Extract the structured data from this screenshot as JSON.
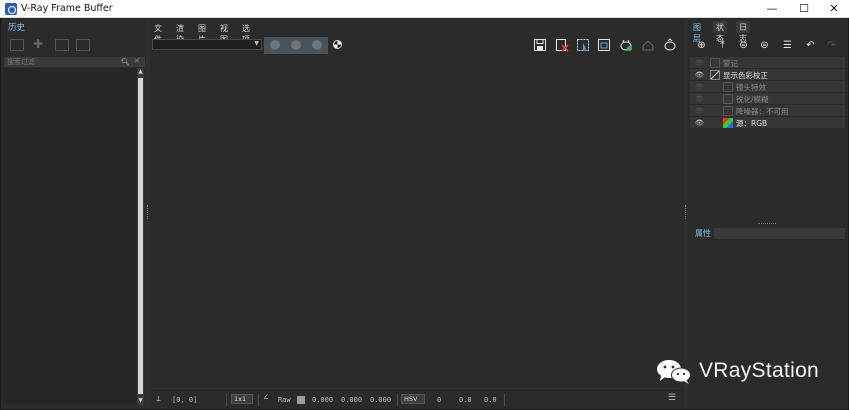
{
  "window": {
    "title": "V-Ray Frame Buffer",
    "controls": {
      "minimize": "—",
      "maximize": "☐",
      "close": "✕"
    }
  },
  "left_panel": {
    "tab": "历史",
    "search": {
      "placeholder": "搜索过滤",
      "value": ""
    },
    "toolbar_icons": [
      "save-to-history-icon",
      "add-history-icon",
      "load-history-icon",
      "export-history-icon"
    ]
  },
  "menubar": [
    "文件",
    "渲染",
    "图片",
    "视图",
    "选项"
  ],
  "toolbar": {
    "channel_select": "",
    "channel_buttons": [
      "red-channel",
      "green-channel",
      "blue-channel"
    ],
    "right_icons": [
      "save-image-icon",
      "clear-image-icon",
      "region-render-icon",
      "follow-mouse-icon",
      "render-icon",
      "stop-render-icon",
      "interactive-render-icon"
    ]
  },
  "statusbar": {
    "coords": "[0, 0]",
    "mode_select": "1x1",
    "raw_label": "Raw",
    "raw_values": [
      "0.000",
      "0.000",
      "0.000"
    ],
    "color_space_select": "HSV",
    "hsv_values": [
      "0",
      "0.0",
      "0.0"
    ]
  },
  "right_panel": {
    "tabs": [
      "图层",
      "状态",
      "日志"
    ],
    "active_tab": "图层",
    "toolbar_icons": [
      "add-layer-icon",
      "load-layers-icon",
      "save-layers-icon",
      "layer-presets-icon",
      "layer-list-icon",
      "undo-icon",
      "redo-icon"
    ],
    "layers": [
      {
        "label": "蒙记",
        "visible": false,
        "indent": 1,
        "dim": true
      },
      {
        "label": "显示色彩校正",
        "visible": true,
        "indent": 1,
        "dim": false
      },
      {
        "label": "镜头特效",
        "visible": false,
        "indent": 2,
        "dim": true
      },
      {
        "label": "锐化/模糊",
        "visible": false,
        "indent": 2,
        "dim": true
      },
      {
        "label": "降噪器：不可用",
        "visible": false,
        "indent": 2,
        "dim": true
      },
      {
        "label": "源：RGB",
        "visible": true,
        "indent": 2,
        "dim": false
      }
    ],
    "properties_label": "属性"
  },
  "watermark": {
    "text": "VRayStation"
  }
}
